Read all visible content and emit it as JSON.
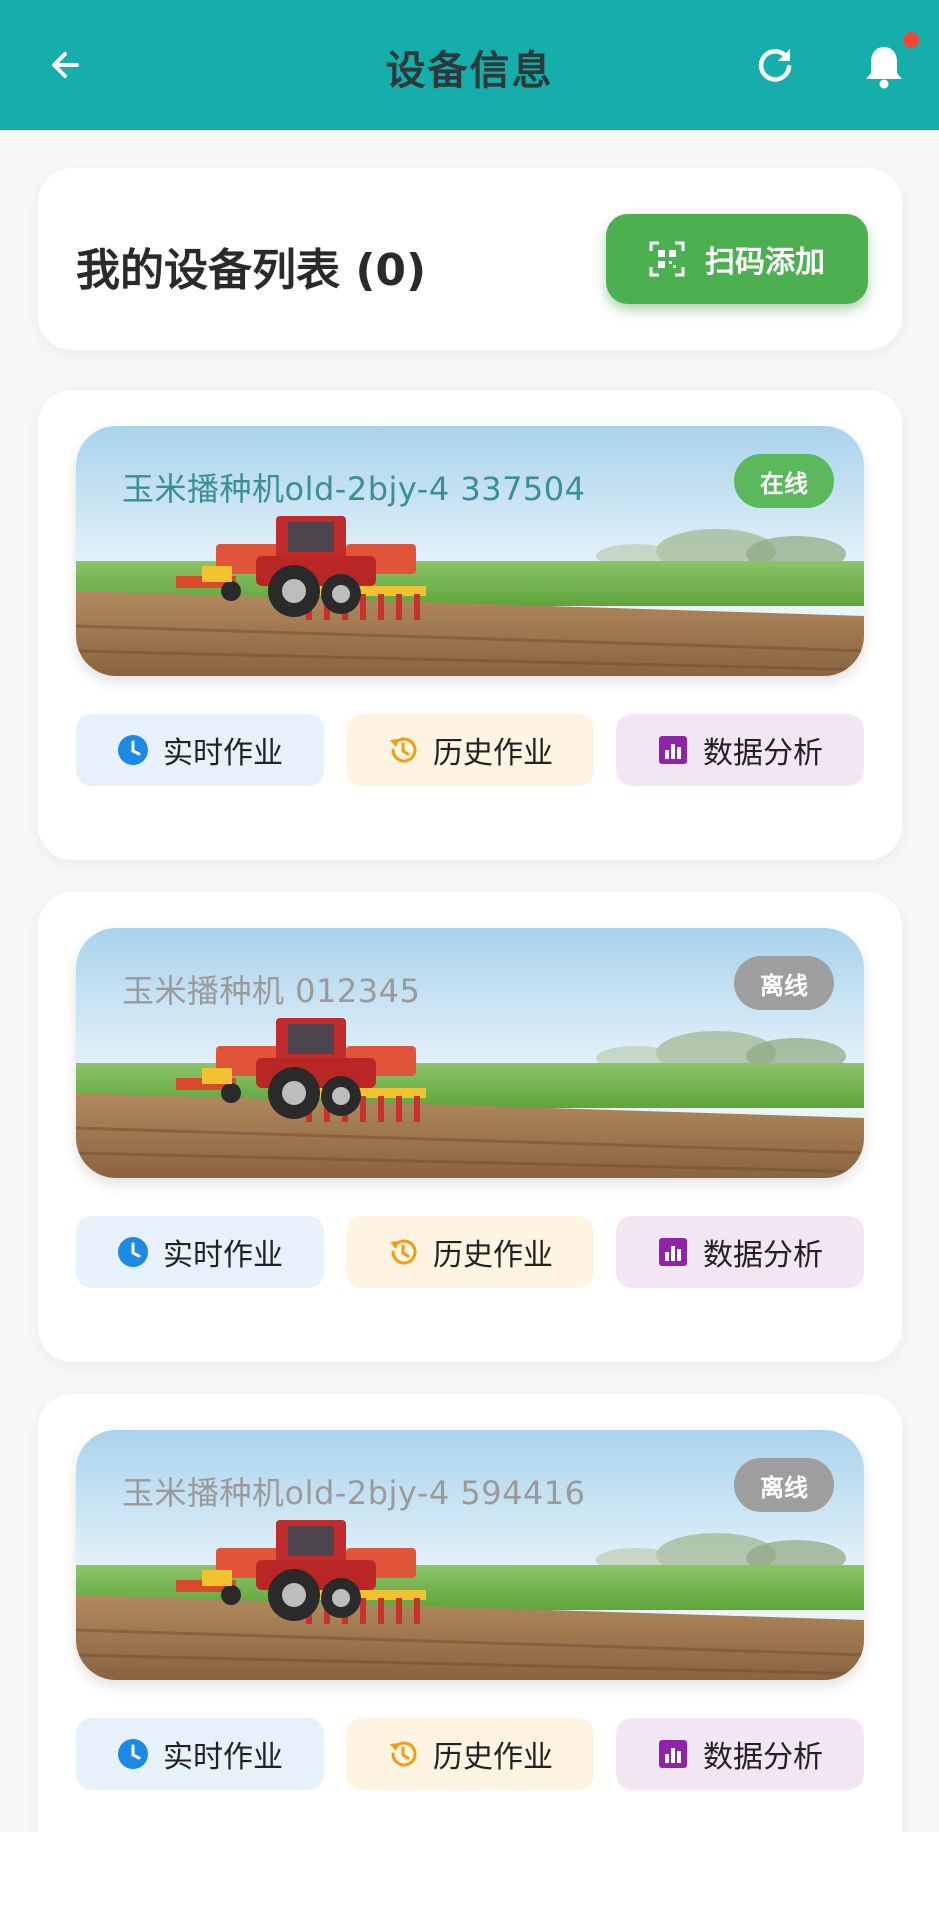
{
  "header": {
    "title": "设备信息"
  },
  "list": {
    "title": "我的设备列表 (0)",
    "scan_label": "扫码添加"
  },
  "colors": {
    "brand": "#16aeab",
    "online": "#4caf50",
    "offline": "#9e9e9e",
    "realtime": "#1e88e5",
    "history": "#f39c12",
    "analysis": "#8e24aa"
  },
  "devices": [
    {
      "name": "玉米播种机old-2bjy-4 337504",
      "status": "在线",
      "realtime_label": "实时作业",
      "history_label": "历史作业",
      "analysis_label": "数据分析"
    },
    {
      "name": "玉米播种机 012345",
      "status": "离线",
      "realtime_label": "实时作业",
      "history_label": "历史作业",
      "analysis_label": "数据分析"
    },
    {
      "name": "玉米播种机old-2bjy-4 594416",
      "status": "离线",
      "realtime_label": "实时作业",
      "history_label": "历史作业",
      "analysis_label": "数据分析"
    }
  ]
}
